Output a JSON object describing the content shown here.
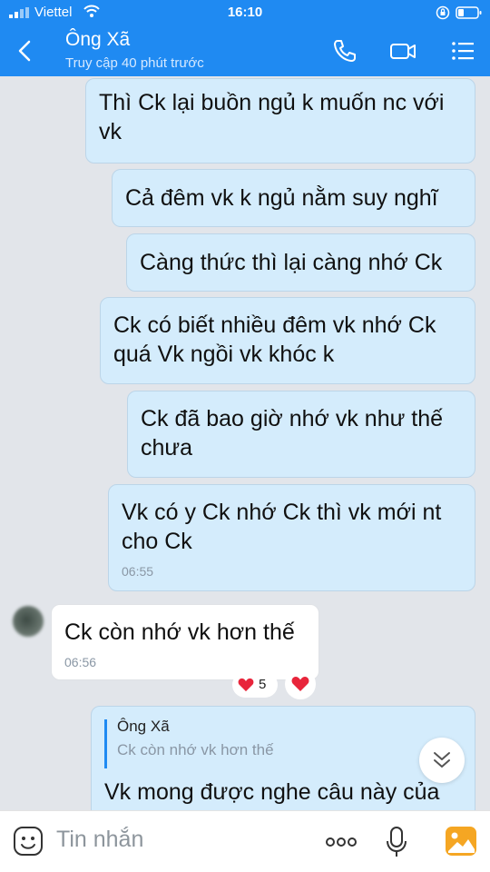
{
  "status_bar": {
    "carrier": "Viettel",
    "time": "16:10"
  },
  "header": {
    "contact_name": "Ông Xã",
    "last_seen": "Truy cập 40 phút trước"
  },
  "messages": [
    {
      "dir": "out",
      "lines": [
        "Thì Ck lại buồn ngủ k muốn nc với",
        "vk"
      ]
    },
    {
      "dir": "out",
      "lines": [
        "Cả đêm vk k ngủ nằm suy nghĩ"
      ]
    },
    {
      "dir": "out",
      "lines": [
        "Càng thức thì lại càng nhớ Ck"
      ]
    },
    {
      "dir": "out",
      "lines": [
        "Ck có biết nhiều đêm vk nhớ Ck",
        "quá Vk ngồi vk khóc k"
      ]
    },
    {
      "dir": "out",
      "lines": [
        "Ck đã bao giờ nhớ vk như thế",
        "chưa"
      ]
    },
    {
      "dir": "out",
      "lines": [
        "Vk có y Ck nhớ Ck thì vk mới nt",
        "cho Ck"
      ],
      "time": "06:55"
    },
    {
      "dir": "in",
      "lines": [
        "Ck còn nhớ vk hơn thế"
      ],
      "time": "06:56"
    }
  ],
  "reaction": {
    "count": "5",
    "heart_color": "#e8253b"
  },
  "quote": {
    "name": "Ông Xã",
    "text": "Ck còn nhớ vk hơn thế",
    "message": "Vk mong được nghe câu này của"
  },
  "input": {
    "placeholder": "Tin nhắn"
  },
  "colors": {
    "accent": "#1f8af2",
    "outgoing_bubble": "#d4ecfc",
    "incoming_bubble": "#ffffff",
    "background": "#e2e5ea"
  },
  "icons": [
    "back-icon",
    "phone-icon",
    "video-call-icon",
    "menu-icon",
    "heart-icon",
    "chevron-down-icon",
    "emoji-icon",
    "more-icon",
    "mic-icon",
    "image-icon"
  ]
}
